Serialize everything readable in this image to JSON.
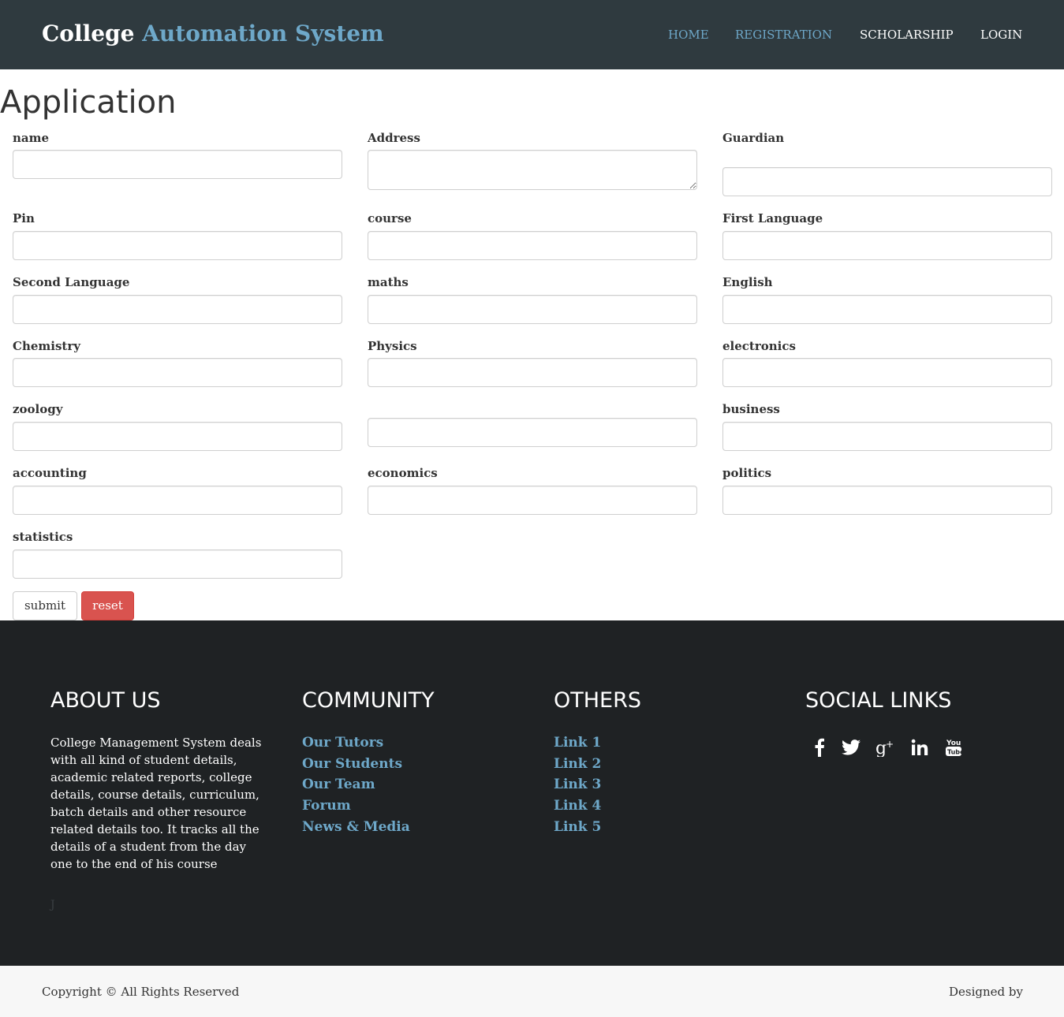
{
  "header": {
    "brand_part1": "College",
    "brand_part2": "Automation System",
    "nav": {
      "home": "HOME",
      "registration": "REGISTRATION",
      "scholarship": "SCHOLARSHIP",
      "login": "LOGIN"
    }
  },
  "page_title": "Application",
  "form": {
    "labels": {
      "name": "name",
      "address": "Address",
      "guardian": "Guardian",
      "pin": "Pin",
      "course": "course",
      "first_language": "First Language",
      "second_language": "Second Language",
      "maths": "maths",
      "english": "English",
      "chemistry": "Chemistry",
      "physics": "Physics",
      "electronics": "electronics",
      "zoology": "zoology",
      "business": "business",
      "accounting": "accounting",
      "economics": "economics",
      "politics": "politics",
      "statistics": "statistics"
    },
    "submit_label": "submit",
    "reset_label": "reset"
  },
  "footer": {
    "about": {
      "heading": "ABOUT US",
      "text": "College Management System deals with all kind of student details, academic related reports, college details, course details, curriculum, batch details and other resource related details too. It tracks all the details of a student from the day one to the end of his course",
      "mark": "J"
    },
    "community": {
      "heading": "COMMUNITY",
      "links": [
        "Our Tutors",
        "Our Students",
        "Our Team",
        "Forum",
        "News & Media"
      ]
    },
    "others": {
      "heading": "OTHERS",
      "links": [
        "Link 1",
        "Link 2",
        "Link 3",
        "Link 4",
        "Link 5"
      ]
    },
    "social": {
      "heading": "SOCIAL LINKS",
      "icons": [
        "facebook-icon",
        "twitter-icon",
        "google-plus-icon",
        "linkedin-icon",
        "youtube-icon"
      ]
    },
    "copyright": "Copyright © All Rights Reserved",
    "designed_by": "Designed by"
  },
  "colors": {
    "navbar_bg": "#2f3a3f",
    "accent": "#6ea8c9",
    "reset_button": "#d9534f",
    "footer_bg": "#1f2224",
    "bottom_bar_bg": "#f7f7f7"
  }
}
